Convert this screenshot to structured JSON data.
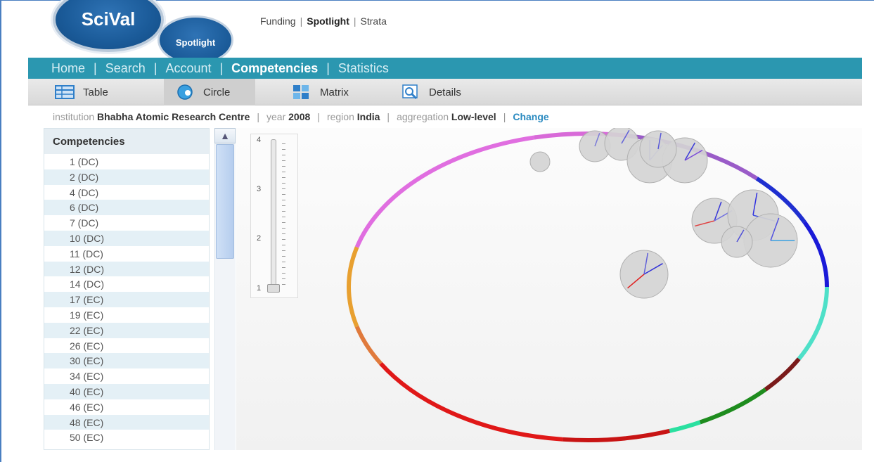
{
  "logo": {
    "main": "SciVal",
    "sub": "Spotlight"
  },
  "top_links": {
    "funding": "Funding",
    "spotlight": "Spotlight",
    "strata": "Strata",
    "sep": "|"
  },
  "main_nav": {
    "home": "Home",
    "search": "Search",
    "account": "Account",
    "competencies": "Competencies",
    "statistics": "Statistics",
    "sep": "|"
  },
  "view_tabs": {
    "table": "Table",
    "circle": "Circle",
    "matrix": "Matrix",
    "details": "Details",
    "active": "Circle"
  },
  "filter": {
    "institution_label": "institution",
    "institution": "Bhabha Atomic Research Centre",
    "year_label": "year",
    "year": "2008",
    "region_label": "region",
    "region": "India",
    "aggregation_label": "aggregation",
    "aggregation": "Low-level",
    "change": "Change",
    "sep": "|"
  },
  "sidebar": {
    "header": "Competencies",
    "items": [
      "1 (DC)",
      "2 (DC)",
      "4 (DC)",
      "6 (DC)",
      "7 (DC)",
      "10 (DC)",
      "11 (DC)",
      "12 (DC)",
      "14 (DC)",
      "17 (EC)",
      "19 (EC)",
      "22 (EC)",
      "26 (EC)",
      "30 (EC)",
      "34 (EC)",
      "40 (EC)",
      "46 (EC)",
      "48 (EC)",
      "50 (EC)"
    ]
  },
  "slider": {
    "labels": [
      "4",
      "3",
      "2",
      "1"
    ],
    "value": 1
  },
  "colors": {
    "nav": "#2b97b0",
    "accent": "#2a8ac0"
  }
}
